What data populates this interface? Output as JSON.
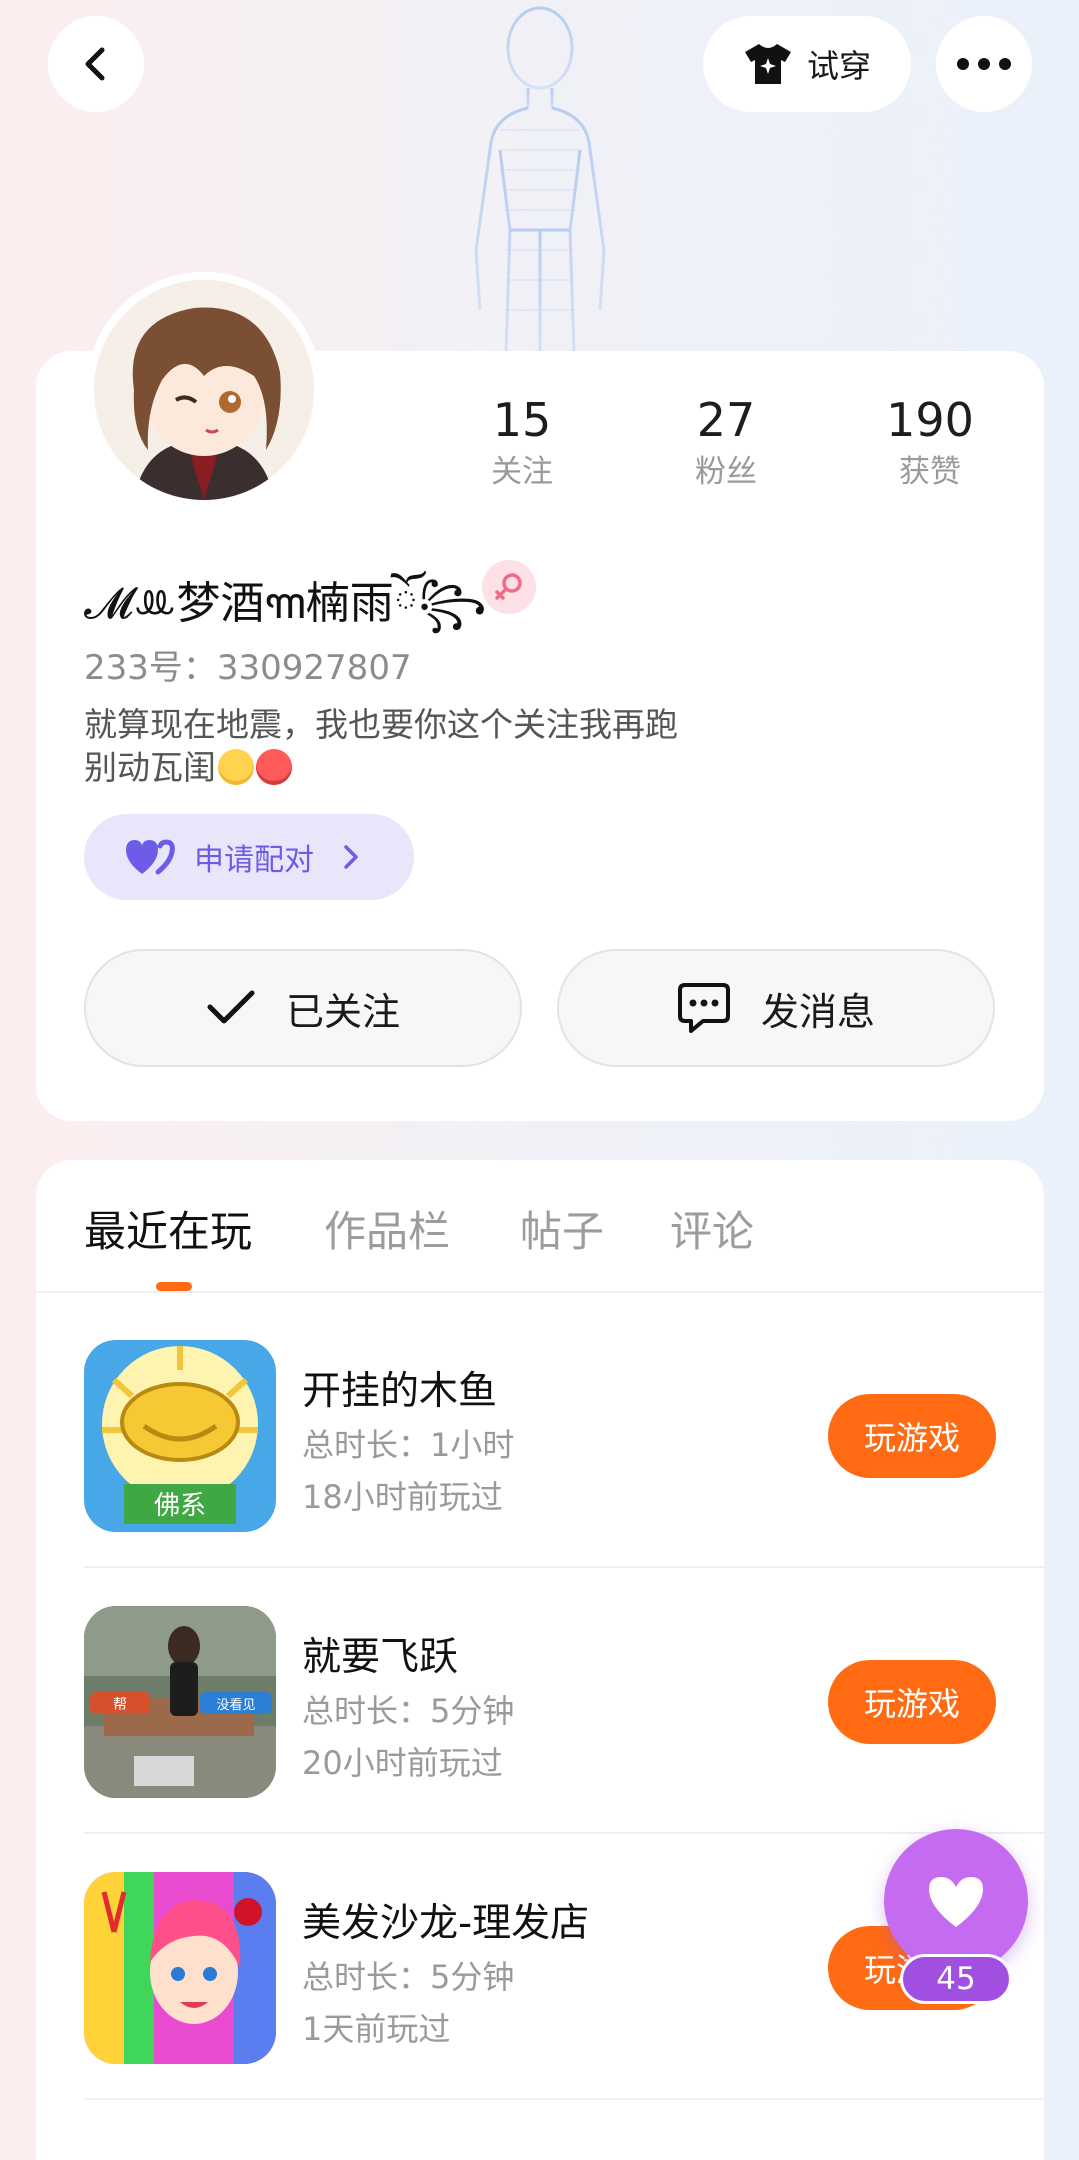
{
  "header": {
    "tryon_label": "试穿"
  },
  "profile": {
    "stats": [
      {
        "value": "15",
        "label": "关注"
      },
      {
        "value": "27",
        "label": "粉丝"
      },
      {
        "value": "190",
        "label": "获赞"
      }
    ],
    "nickname": "𝓜ꔛ梦酒꧑楠雨ོ꧂",
    "user_id": "233号：330927807",
    "bio_line1": "就算现在地震，我也要你这个关注我再跑",
    "bio_line2": "别动瓦闺",
    "match_label": "申请配对",
    "followed_label": "已关注",
    "message_label": "发消息"
  },
  "tabs": [
    {
      "label": "最近在玩",
      "active": true
    },
    {
      "label": "作品栏",
      "active": false
    },
    {
      "label": "帖子",
      "active": false
    },
    {
      "label": "评论",
      "active": false
    }
  ],
  "games": [
    {
      "title": "开挂的木鱼",
      "duration": "总时长：1小时",
      "last_played": "18小时前玩过",
      "button": "玩游戏",
      "icon_text": "佛系"
    },
    {
      "title": "就要飞跃",
      "duration": "总时长：5分钟",
      "last_played": "20小时前玩过",
      "button": "玩游戏",
      "icon_left": "帮",
      "icon_right": "没看见"
    },
    {
      "title": "美发沙龙-理发店",
      "duration": "总时长：5分钟",
      "last_played": "1天前玩过",
      "button": "玩游戏"
    }
  ],
  "like": {
    "count": "45"
  },
  "colors": {
    "accent": "#ff6a13",
    "match": "#6c5ce7",
    "like": "#c56bf0"
  }
}
